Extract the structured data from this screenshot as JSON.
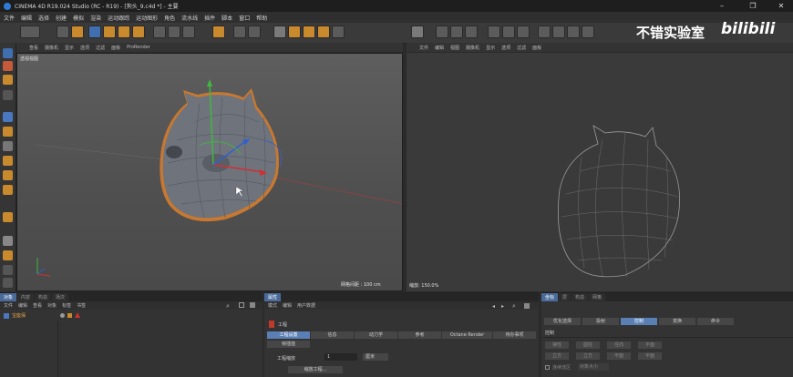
{
  "window": {
    "title": "CINEMA 4D R19.024 Studio (RC - R19) - [狗头_9.c4d *] - 主要",
    "min": "–",
    "max": "❐",
    "close": "✕"
  },
  "menubar": [
    "文件",
    "编辑",
    "选择",
    "创建",
    "模拟",
    "渲染",
    "运动跟踪",
    "运动图形",
    "角色",
    "流水线",
    "插件",
    "脚本",
    "窗口",
    "帮助"
  ],
  "watermark": {
    "text": "不错实验室",
    "brand": "bilibili"
  },
  "viewport_left": {
    "menu": [
      "查看",
      "摄像机",
      "显示",
      "选项",
      "过滤",
      "面板",
      "ProRender"
    ],
    "label": "透视视图",
    "grid_info": "网格间距 : 100 cm"
  },
  "viewport_right": {
    "menu": [
      "文件",
      "编辑",
      "视图",
      "摄像机",
      "显示",
      "选项",
      "过滤",
      "面板"
    ],
    "zoom": "缩放: 150.0%"
  },
  "objects_panel": {
    "tabs": [
      "对象",
      "内容",
      "构造",
      "场次"
    ],
    "menu": [
      "文件",
      "编辑",
      "查看",
      "对象",
      "标签",
      "书签"
    ],
    "item": "宝座保"
  },
  "attributes_panel": {
    "tab": "属性",
    "menu": [
      "模式",
      "编辑",
      "用户数据"
    ],
    "section": "工程",
    "buttons": [
      "工程设置",
      "信息",
      "动力学",
      "参考",
      "Octane Render",
      "待办事项"
    ],
    "sub_button": "帧插值",
    "field_label": "工程缩放",
    "field_value": "1",
    "field_unit": "厘米",
    "scale_button": "缩放工程..."
  },
  "right_panel": {
    "tabs": [
      "坐标",
      "层",
      "构造",
      "网格"
    ],
    "modes": [
      "优化选择",
      "投射",
      "控制",
      "变换",
      "命令"
    ],
    "active_mode": "控制",
    "section": "控制",
    "buttons": [
      "弹性",
      "圆柱",
      "径向",
      "平面",
      "立方",
      "立方",
      "平面",
      "平面"
    ],
    "checkbox_label": "连续选区",
    "dropdown": "对象大小"
  }
}
